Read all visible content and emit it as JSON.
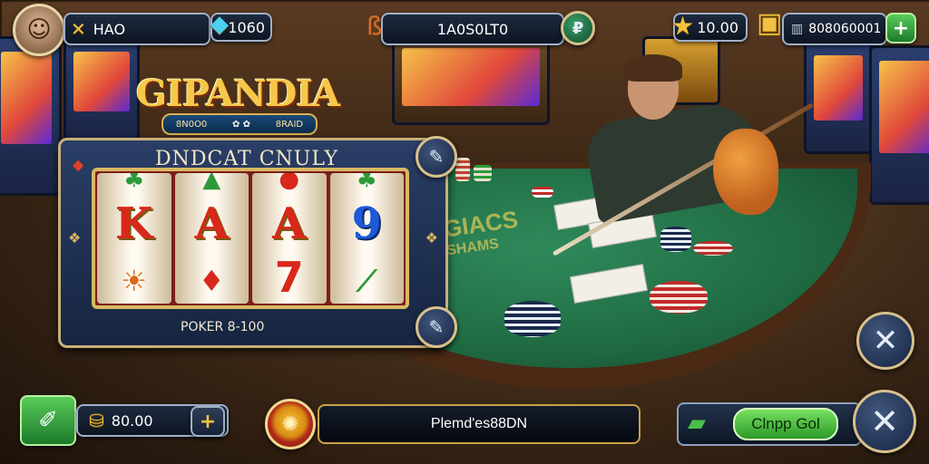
{
  "player": {
    "name": "HAO",
    "gems": "1060"
  },
  "game": {
    "logo": "GIPANDIA",
    "logo_band": "8N0O0",
    "logo_band_right": "8RAID",
    "center_balance": "1A0S0LT0"
  },
  "top_right": {
    "stars": "10.00",
    "chips": "808060001"
  },
  "slot": {
    "title": "DNDCAT CNULY",
    "reels": [
      {
        "main": "K",
        "bottom": "☀"
      },
      {
        "main": "A",
        "bottom": "♦"
      },
      {
        "main": "A",
        "bottom": "7"
      },
      {
        "main": "9",
        "bottom": "⟋"
      }
    ],
    "bet_label": "POKER 8-100"
  },
  "felt": {
    "line1": "GIACS",
    "line2": "SHAMS"
  },
  "bottom": {
    "bet_amount": "80.00",
    "message": "Plemd'es88DN",
    "claim_label": "Clnpp Gol"
  },
  "icons": {
    "tools": "tools-icon",
    "gem": "gem-icon",
    "key": "key-icon",
    "cash": "cash-icon",
    "star": "star-icon",
    "chest": "chest-icon",
    "close": "close-icon",
    "edit": "edit-icon",
    "wand": "wand-icon",
    "stack": "chip-stack-icon",
    "coin": "coin-icon",
    "bill": "money-icon"
  },
  "colors": {
    "gold": "#f3c240",
    "accent_green": "#2a9a28",
    "panel": "#162540"
  }
}
